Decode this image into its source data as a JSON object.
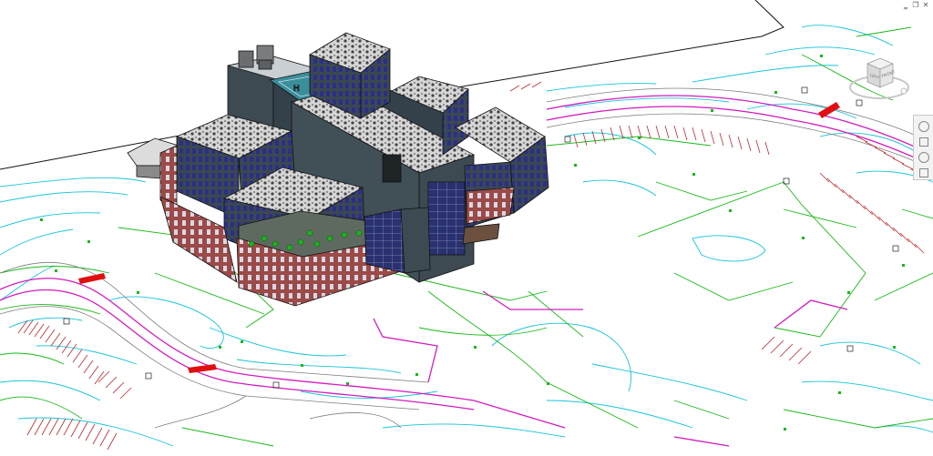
{
  "window": {
    "controls": [
      "minimize-icon",
      "restore-icon",
      "close-icon"
    ],
    "control_glyphs": [
      "‗",
      "❐",
      "✕"
    ]
  },
  "viewcube": {
    "faces": [
      "LEFT",
      "FRONT"
    ]
  },
  "colors": {
    "contour_cyan": "#19c4d8",
    "contour_green": "#18b818",
    "property_magenta": "#d21cbe",
    "parking_red": "#c0282c",
    "site_boundary": "#111111",
    "brick": "#9a4a45",
    "roof": "#c4c4c4",
    "glass": "#2a2f6b",
    "facade_dark": "#3d4a52"
  }
}
